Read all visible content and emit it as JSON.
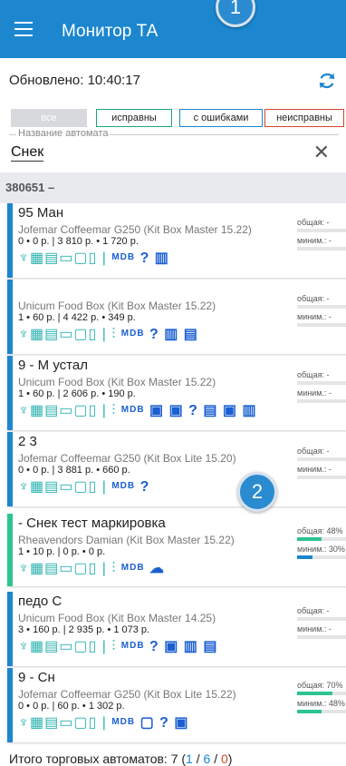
{
  "appbar": {
    "title": "Монитор ТА"
  },
  "markers": [
    "1",
    "2"
  ],
  "status": {
    "updated": "Обновлено: 10:40:17"
  },
  "filters": [
    {
      "label": "все"
    },
    {
      "label": "исправны"
    },
    {
      "label": "с ошибками"
    },
    {
      "label": "неисправны"
    }
  ],
  "search": {
    "label": "Название автомата",
    "value": "Снек"
  },
  "group": {
    "header": "380651 –"
  },
  "cards": [
    {
      "num": "95 Ман",
      "model": "Jofemar Coffeemar G250 (Kit Box Master 15.22)",
      "stats": "0 • 0 р. | 3 810 р. • 1 720 р.",
      "total_label": "общая: -",
      "min_label": "миним.: -"
    },
    {
      "num": "",
      "model": "Unicum Food Box (Kit Box Master 15.22)",
      "stats": "1 • 60 р. | 4 422 р. • 349 р.",
      "total_label": "общая: -",
      "min_label": "миним.: -"
    },
    {
      "num": "9 - М устал",
      "model": "Unicum Food Box (Kit Box Master 15.22)",
      "stats": "1 • 60 р. | 2 606 р. • 190 р.",
      "total_label": "общая: -",
      "min_label": "миним.: -"
    },
    {
      "num": "2 3",
      "model": "Jofemar Coffeemar G250 (Kit Box Lite 15.20)",
      "stats": "0 • 0 р. | 3 881 р. • 660 р.",
      "total_label": "общая: -",
      "min_label": "миним.: -"
    },
    {
      "num": "- Снек тест маркировка",
      "model": "Rheavendors Damian (Kit Box Master 15.22)",
      "stats": "1 • 10 р. | 0 р. • 0 р.",
      "total_label": "общая: 48%",
      "min_label": "миним.: 30%",
      "total_pct": 48,
      "min_pct": 30
    },
    {
      "num": "педо С",
      "model": "Unicum Food Box (Kit Box Master 14.25)",
      "stats": "3 • 160 р. | 2 935 р. • 1 073 р.",
      "total_label": "общая: -",
      "min_label": "миним.: -"
    },
    {
      "num": "9 - Сн",
      "model": "Jofemar Coffeemar G250 (Kit Box Lite 15.22)",
      "stats": "0 • 0 р. | 60 р. • 1 302 р.",
      "total_label": "общая: 70%",
      "min_label": "миним.: 48%",
      "total_pct": 70,
      "min_pct": 48
    }
  ],
  "footer": {
    "text": "Итого торговых автоматов: 7 (",
    "ok": "1",
    "sep1": " / ",
    "err": "6",
    "sep2": " / ",
    "bad": "0",
    "end": ")"
  },
  "colors": {
    "primary": "#1c86cf",
    "ok": "#2ec490",
    "bad": "#d6452c"
  }
}
